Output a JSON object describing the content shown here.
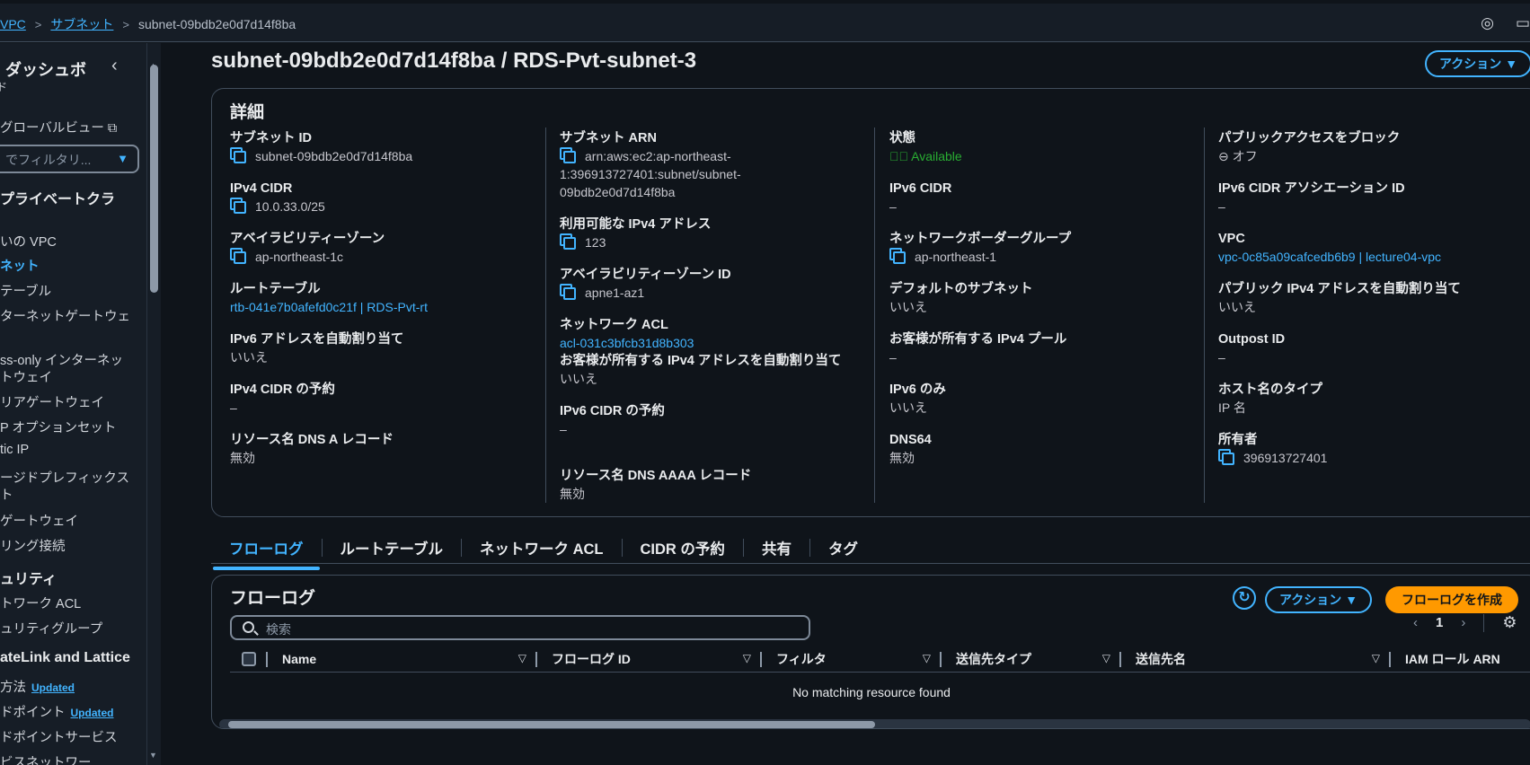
{
  "breadcrumb": {
    "vpc": "VPC",
    "subnets": "サブネット",
    "current": "subnet-09bdb2e0d7d14f8ba"
  },
  "topbar": {
    "icon1": "◎",
    "icon2": "▭"
  },
  "sidebar": {
    "title": "ダッシュボ",
    "title2": "ド",
    "global_view": "グローバルビュー",
    "filter_placeholder": "でフィルタリ...",
    "section_private_cloud": "プライベートクラ",
    "items": [
      "いの VPC",
      "ネット",
      "テーブル",
      "ターネットゲートウェ",
      "",
      "ss-only インターネッ",
      "トウェイ",
      "リアゲートウェイ",
      "P オプションセット",
      "tic IP",
      "ージドプレフィックス",
      "ト",
      "ゲートウェイ",
      "リング接続"
    ],
    "section_security": "ュリティ",
    "security_items": [
      "トワーク ACL",
      "ュリティグループ"
    ],
    "section_privatelink": "ateLink and Lattice",
    "pl_items": [
      "方法",
      "ドポイント",
      "ドポイントサービス",
      "ビスネットワー"
    ],
    "updated_badge": "Updated"
  },
  "page": {
    "title": "subnet-09bdb2e0d7d14f8ba / RDS-Pvt-subnet-3",
    "actions_button": "アクション ▼"
  },
  "details": {
    "title": "詳細",
    "col1": [
      {
        "label": "サブネット ID",
        "value": "subnet-09bdb2e0d7d14f8ba"
      },
      {
        "label": "IPv4 CIDR",
        "value": "10.0.33.0/25"
      },
      {
        "label": "アベイラビリティーゾーン",
        "value": "ap-northeast-1c"
      },
      {
        "label": "ルートテーブル",
        "value": "rtb-041e7b0afefd0c21f | RDS-Pvt-rt"
      },
      {
        "label": "IPv6 アドレスを自動割り当て",
        "value": "いいえ"
      },
      {
        "label": "IPv4 CIDR の予約",
        "value": "–"
      },
      {
        "label": "リソース名 DNS A レコード",
        "value": "無効"
      }
    ],
    "col2": [
      {
        "label": "サブネット ARN",
        "value": "arn:aws:ec2:ap-northeast-1:396913727401:subnet/subnet-09bdb2e0d7d14f8ba",
        "value_line1": "arn:aws:ec2:ap-northeast-",
        "value_line2": "1:396913727401:subnet/subnet-",
        "value_line3": "09bdb2e0d7d14f8ba"
      },
      {
        "label": "利用可能な IPv4 アドレス",
        "value": "123"
      },
      {
        "label": "アベイラビリティーゾーン ID",
        "value": "apne1-az1"
      },
      {
        "label": "ネットワーク ACL",
        "value": "acl-031c3bfcb31d8b303"
      },
      {
        "label": "お客様が所有する IPv4 アドレスを自動割り当て",
        "value": "いいえ"
      },
      {
        "label": "IPv6 CIDR の予約",
        "value": "–"
      },
      {
        "label": "リソース名 DNS AAAA レコード",
        "value": "無効"
      }
    ],
    "col3": [
      {
        "label": "状態",
        "value": "Available"
      },
      {
        "label": "IPv6 CIDR",
        "value": "–"
      },
      {
        "label": "ネットワークボーダーグループ",
        "value": "ap-northeast-1"
      },
      {
        "label": "デフォルトのサブネット",
        "value": "いいえ"
      },
      {
        "label": "お客様が所有する IPv4 プール",
        "value": "–"
      },
      {
        "label": "IPv6 のみ",
        "value": "いいえ"
      },
      {
        "label": "DNS64",
        "value": "無効"
      }
    ],
    "col4": [
      {
        "label": "パブリックアクセスをブロック",
        "value": "オフ"
      },
      {
        "label": "IPv6 CIDR アソシエーション ID",
        "value": "–"
      },
      {
        "label": "VPC",
        "value": "vpc-0c85a09cafcedb6b9 | lecture04-vpc"
      },
      {
        "label": "パブリック IPv4 アドレスを自動割り当て",
        "value": "いいえ"
      },
      {
        "label": "Outpost ID",
        "value": "–"
      },
      {
        "label": "ホスト名のタイプ",
        "value": "IP 名"
      },
      {
        "label": "所有者",
        "value": "396913727401"
      }
    ]
  },
  "tabs": [
    "フローログ",
    "ルートテーブル",
    "ネットワーク ACL",
    "CIDR の予約",
    "共有",
    "タグ"
  ],
  "flowlogs": {
    "title": "フローログ",
    "actions_button": "アクション ▼",
    "create_button": "フローログを作成",
    "search_placeholder": "検索",
    "page_number": "1",
    "columns": [
      "Name",
      "フローログ ID",
      "フィルタ",
      "送信先タイプ",
      "送信先名",
      "IAM ロール ARN"
    ],
    "empty_message": "No matching resource found"
  }
}
